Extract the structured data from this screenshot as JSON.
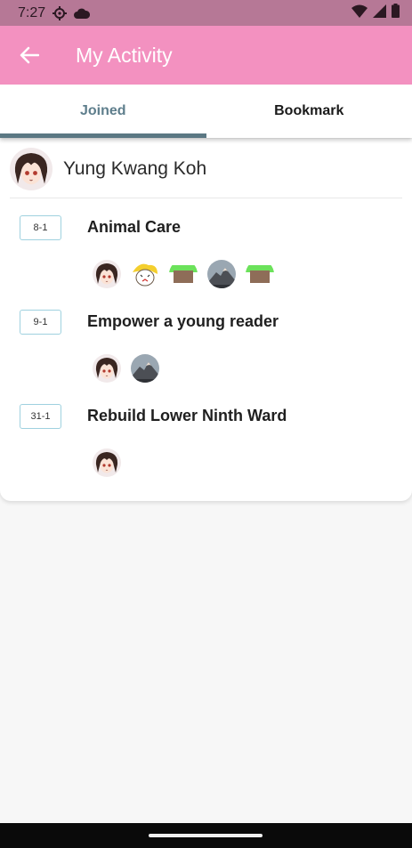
{
  "status_bar": {
    "time": "7:27"
  },
  "app_bar": {
    "title": "My Activity"
  },
  "tabs": [
    {
      "label": "Joined",
      "active": true
    },
    {
      "label": "Bookmark",
      "active": false
    }
  ],
  "user": {
    "name": "Yung Kwang Koh"
  },
  "activities": [
    {
      "date": "8-1",
      "title": "Animal Care",
      "participants": [
        "anime-avatar",
        "cat-sticker-avatar",
        "pixel-avatar",
        "mountain-avatar",
        "pixel-avatar"
      ]
    },
    {
      "date": "9-1",
      "title": "Empower a young reader",
      "participants": [
        "anime-avatar",
        "mountain-avatar"
      ]
    },
    {
      "date": "31-1",
      "title": "Rebuild Lower Ninth Ward",
      "participants": [
        "anime-avatar"
      ]
    }
  ],
  "colors": {
    "app_bar": "#f391c0",
    "status_bar": "#b67896",
    "active_tab": "#5e7e8c",
    "badge_border": "#9fd1df"
  }
}
